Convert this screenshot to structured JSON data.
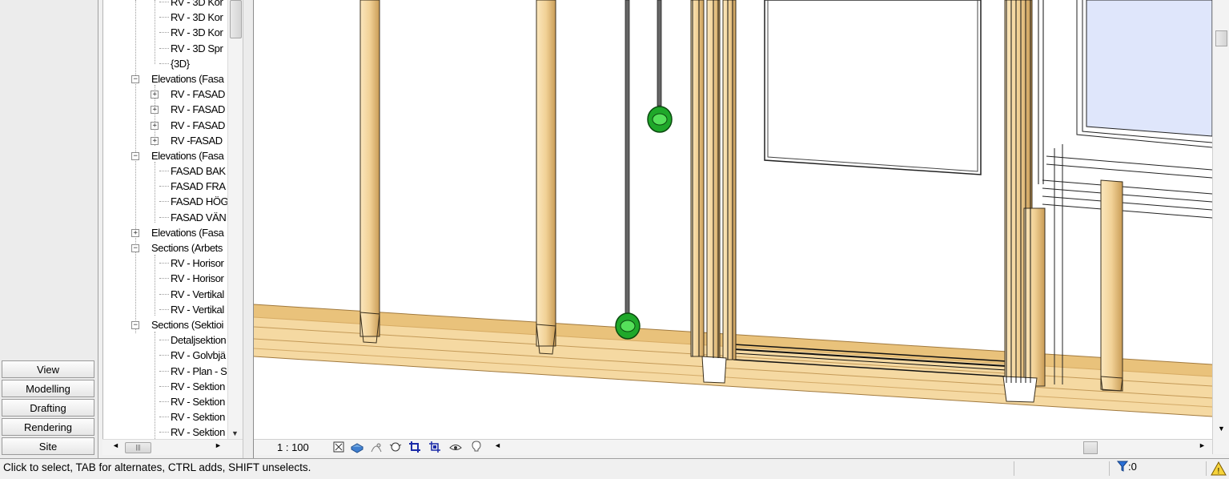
{
  "tabs": [
    "View",
    "Modelling",
    "Drafting",
    "Rendering",
    "Site"
  ],
  "tree": [
    {
      "level": 2,
      "label": "RV - 3D Kor",
      "expander": ""
    },
    {
      "level": 2,
      "label": "RV - 3D Kor",
      "expander": ""
    },
    {
      "level": 2,
      "label": "RV - 3D Kor",
      "expander": ""
    },
    {
      "level": 2,
      "label": "RV - 3D Spr",
      "expander": ""
    },
    {
      "level": 2,
      "label": "{3D}",
      "expander": ""
    },
    {
      "level": 1,
      "label": "Elevations (Fasa",
      "expander": "−"
    },
    {
      "level": 2,
      "label": "RV - FASAD",
      "expander": "+"
    },
    {
      "level": 2,
      "label": "RV - FASAD",
      "expander": "+"
    },
    {
      "level": 2,
      "label": "RV - FASAD",
      "expander": "+"
    },
    {
      "level": 2,
      "label": "RV -FASAD",
      "expander": "+"
    },
    {
      "level": 1,
      "label": "Elevations (Fasa",
      "expander": "−"
    },
    {
      "level": 2,
      "label": "FASAD BAK",
      "expander": ""
    },
    {
      "level": 2,
      "label": "FASAD FRA",
      "expander": ""
    },
    {
      "level": 2,
      "label": "FASAD HÖG",
      "expander": ""
    },
    {
      "level": 2,
      "label": "FASAD VÄN",
      "expander": ""
    },
    {
      "level": 1,
      "label": "Elevations (Fasa",
      "expander": "+"
    },
    {
      "level": 1,
      "label": "Sections (Arbets",
      "expander": "−"
    },
    {
      "level": 2,
      "label": "RV - Horisor",
      "expander": ""
    },
    {
      "level": 2,
      "label": "RV - Horisor",
      "expander": ""
    },
    {
      "level": 2,
      "label": "RV - Vertikal",
      "expander": ""
    },
    {
      "level": 2,
      "label": "RV - Vertikal",
      "expander": ""
    },
    {
      "level": 1,
      "label": "Sections (Sektioi",
      "expander": "−"
    },
    {
      "level": 2,
      "label": "Detaljsektion",
      "expander": ""
    },
    {
      "level": 2,
      "label": "RV - Golvbjä",
      "expander": ""
    },
    {
      "level": 2,
      "label": "RV - Plan - S",
      "expander": ""
    },
    {
      "level": 2,
      "label": "RV - Sektion",
      "expander": ""
    },
    {
      "level": 2,
      "label": "RV - Sektion",
      "expander": ""
    },
    {
      "level": 2,
      "label": "RV - Sektion",
      "expander": ""
    },
    {
      "level": 2,
      "label": "RV - Sektion",
      "expander": ""
    }
  ],
  "view_control": {
    "scale": "1 : 100",
    "icons": [
      "detail-level-icon",
      "visual-style-icon",
      "sun-path-icon",
      "shadows-icon",
      "crop-view-icon",
      "show-crop-region-icon",
      "temporary-hide-icon",
      "reveal-hidden-icon"
    ]
  },
  "status": {
    "message": "Click to select, TAB for alternates, CTRL adds, SHIFT unselects.",
    "filter_count": ":0"
  },
  "colors": {
    "wood_light": "#f7deaa",
    "wood_mid": "#e8c27a",
    "wood_dark": "#c9a05a",
    "fixture_green": "#22b22a",
    "window_glass": "#dfe6fb"
  }
}
